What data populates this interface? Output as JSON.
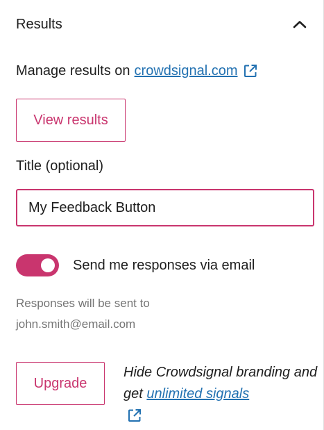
{
  "header": {
    "title": "Results",
    "toggle_icon": "chevron-up-icon"
  },
  "manage": {
    "prefix": "Manage results on",
    "link_text": "crowdsignal.com",
    "link_icon": "external-link-icon"
  },
  "view_results_button": "View results",
  "title_field": {
    "label": "Title (optional)",
    "value": "My Feedback Button"
  },
  "email_toggle": {
    "label": "Send me responses via email",
    "state": "on"
  },
  "help": {
    "line1": "Responses will be sent to",
    "line2": "john.smith@email.com"
  },
  "upgrade": {
    "button": "Upgrade",
    "text_before": "Hide Crowdsignal branding and get",
    "link_text": "unlimited signals",
    "link_icon": "external-link-icon"
  },
  "colors": {
    "accent": "#c9356e",
    "link": "#2271b1",
    "text": "#1e1e1e",
    "muted": "#757575"
  }
}
